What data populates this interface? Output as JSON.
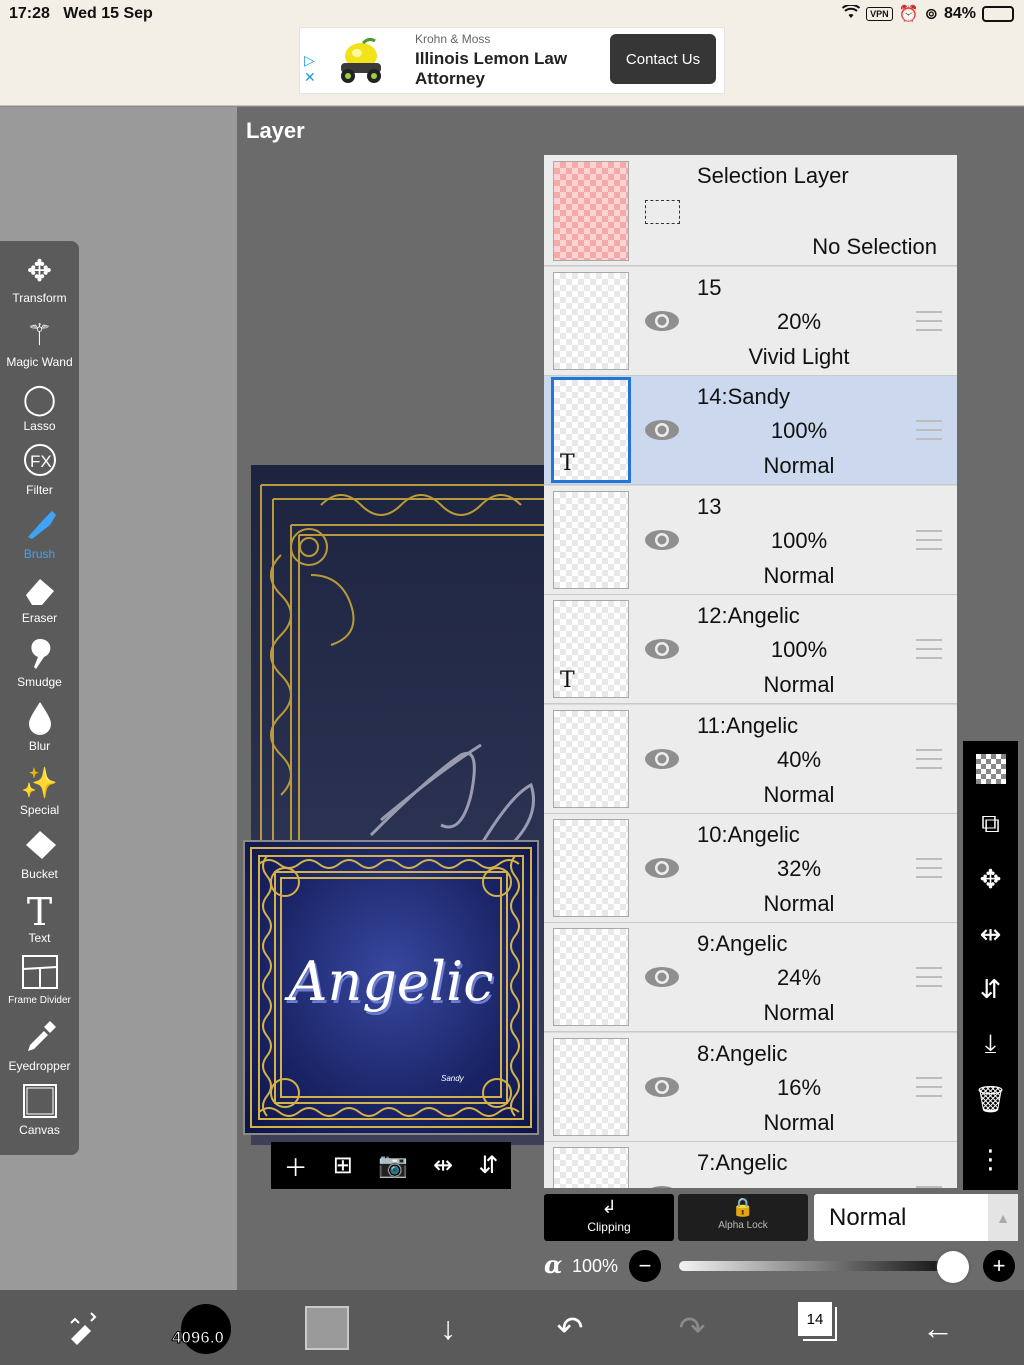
{
  "status": {
    "time": "17:28",
    "date": "Wed 15 Sep",
    "vpn": "VPN",
    "battery": "84%"
  },
  "ad": {
    "brand": "Krohn & Moss",
    "title": "Illinois Lemon Law Attorney",
    "button": "Contact Us"
  },
  "panel": {
    "title": "Layer"
  },
  "tools": [
    {
      "label": "Transform",
      "icon": "move-icon"
    },
    {
      "label": "Magic Wand",
      "icon": "magic-wand-icon"
    },
    {
      "label": "Lasso",
      "icon": "lasso-icon"
    },
    {
      "label": "Filter",
      "icon": "fx-icon"
    },
    {
      "label": "Brush",
      "icon": "brush-icon"
    },
    {
      "label": "Eraser",
      "icon": "eraser-icon"
    },
    {
      "label": "Smudge",
      "icon": "smudge-icon"
    },
    {
      "label": "Blur",
      "icon": "drop-icon"
    },
    {
      "label": "Special",
      "icon": "sparkle-icon"
    },
    {
      "label": "Bucket",
      "icon": "bucket-icon"
    },
    {
      "label": "Text",
      "icon": "text-icon"
    },
    {
      "label": "Frame Divider",
      "icon": "frame-divider-icon"
    },
    {
      "label": "Eyedropper",
      "icon": "eyedropper-icon"
    },
    {
      "label": "Canvas",
      "icon": "canvas-icon"
    }
  ],
  "artwork": {
    "title": "Angelic",
    "signature": "Sandy"
  },
  "selection_layer": {
    "name": "Selection Layer",
    "status": "No Selection"
  },
  "layers": [
    {
      "name": "15",
      "opacity": "20%",
      "blend": "Vivid Light",
      "text": false,
      "selected": false
    },
    {
      "name": "14:Sandy",
      "opacity": "100%",
      "blend": "Normal",
      "text": true,
      "selected": true
    },
    {
      "name": "13",
      "opacity": "100%",
      "blend": "Normal",
      "text": false,
      "selected": false
    },
    {
      "name": "12:Angelic",
      "opacity": "100%",
      "blend": "Normal",
      "text": true,
      "selected": false
    },
    {
      "name": "11:Angelic",
      "opacity": "40%",
      "blend": "Normal",
      "text": false,
      "selected": false
    },
    {
      "name": "10:Angelic",
      "opacity": "32%",
      "blend": "Normal",
      "text": false,
      "selected": false
    },
    {
      "name": "9:Angelic",
      "opacity": "24%",
      "blend": "Normal",
      "text": false,
      "selected": false
    },
    {
      "name": "8:Angelic",
      "opacity": "16%",
      "blend": "Normal",
      "text": false,
      "selected": false
    },
    {
      "name": "7:Angelic",
      "opacity": "",
      "blend": "",
      "text": false,
      "selected": false
    }
  ],
  "layer_controls": {
    "clipping": "Clipping",
    "alpha_lock": "Alpha Lock",
    "blend_mode": "Normal",
    "alpha_symbol": "α",
    "alpha_value": "100%",
    "alpha_level": 1.0
  },
  "bottom": {
    "brush_size": "4096.0",
    "brush_color": "#000000",
    "color": "#9a9a9a",
    "layer_count": "14"
  },
  "colors": {
    "accent": "#2474d8",
    "active_tool": "#3fa3f7",
    "selected_row": "#cbd8ee"
  }
}
